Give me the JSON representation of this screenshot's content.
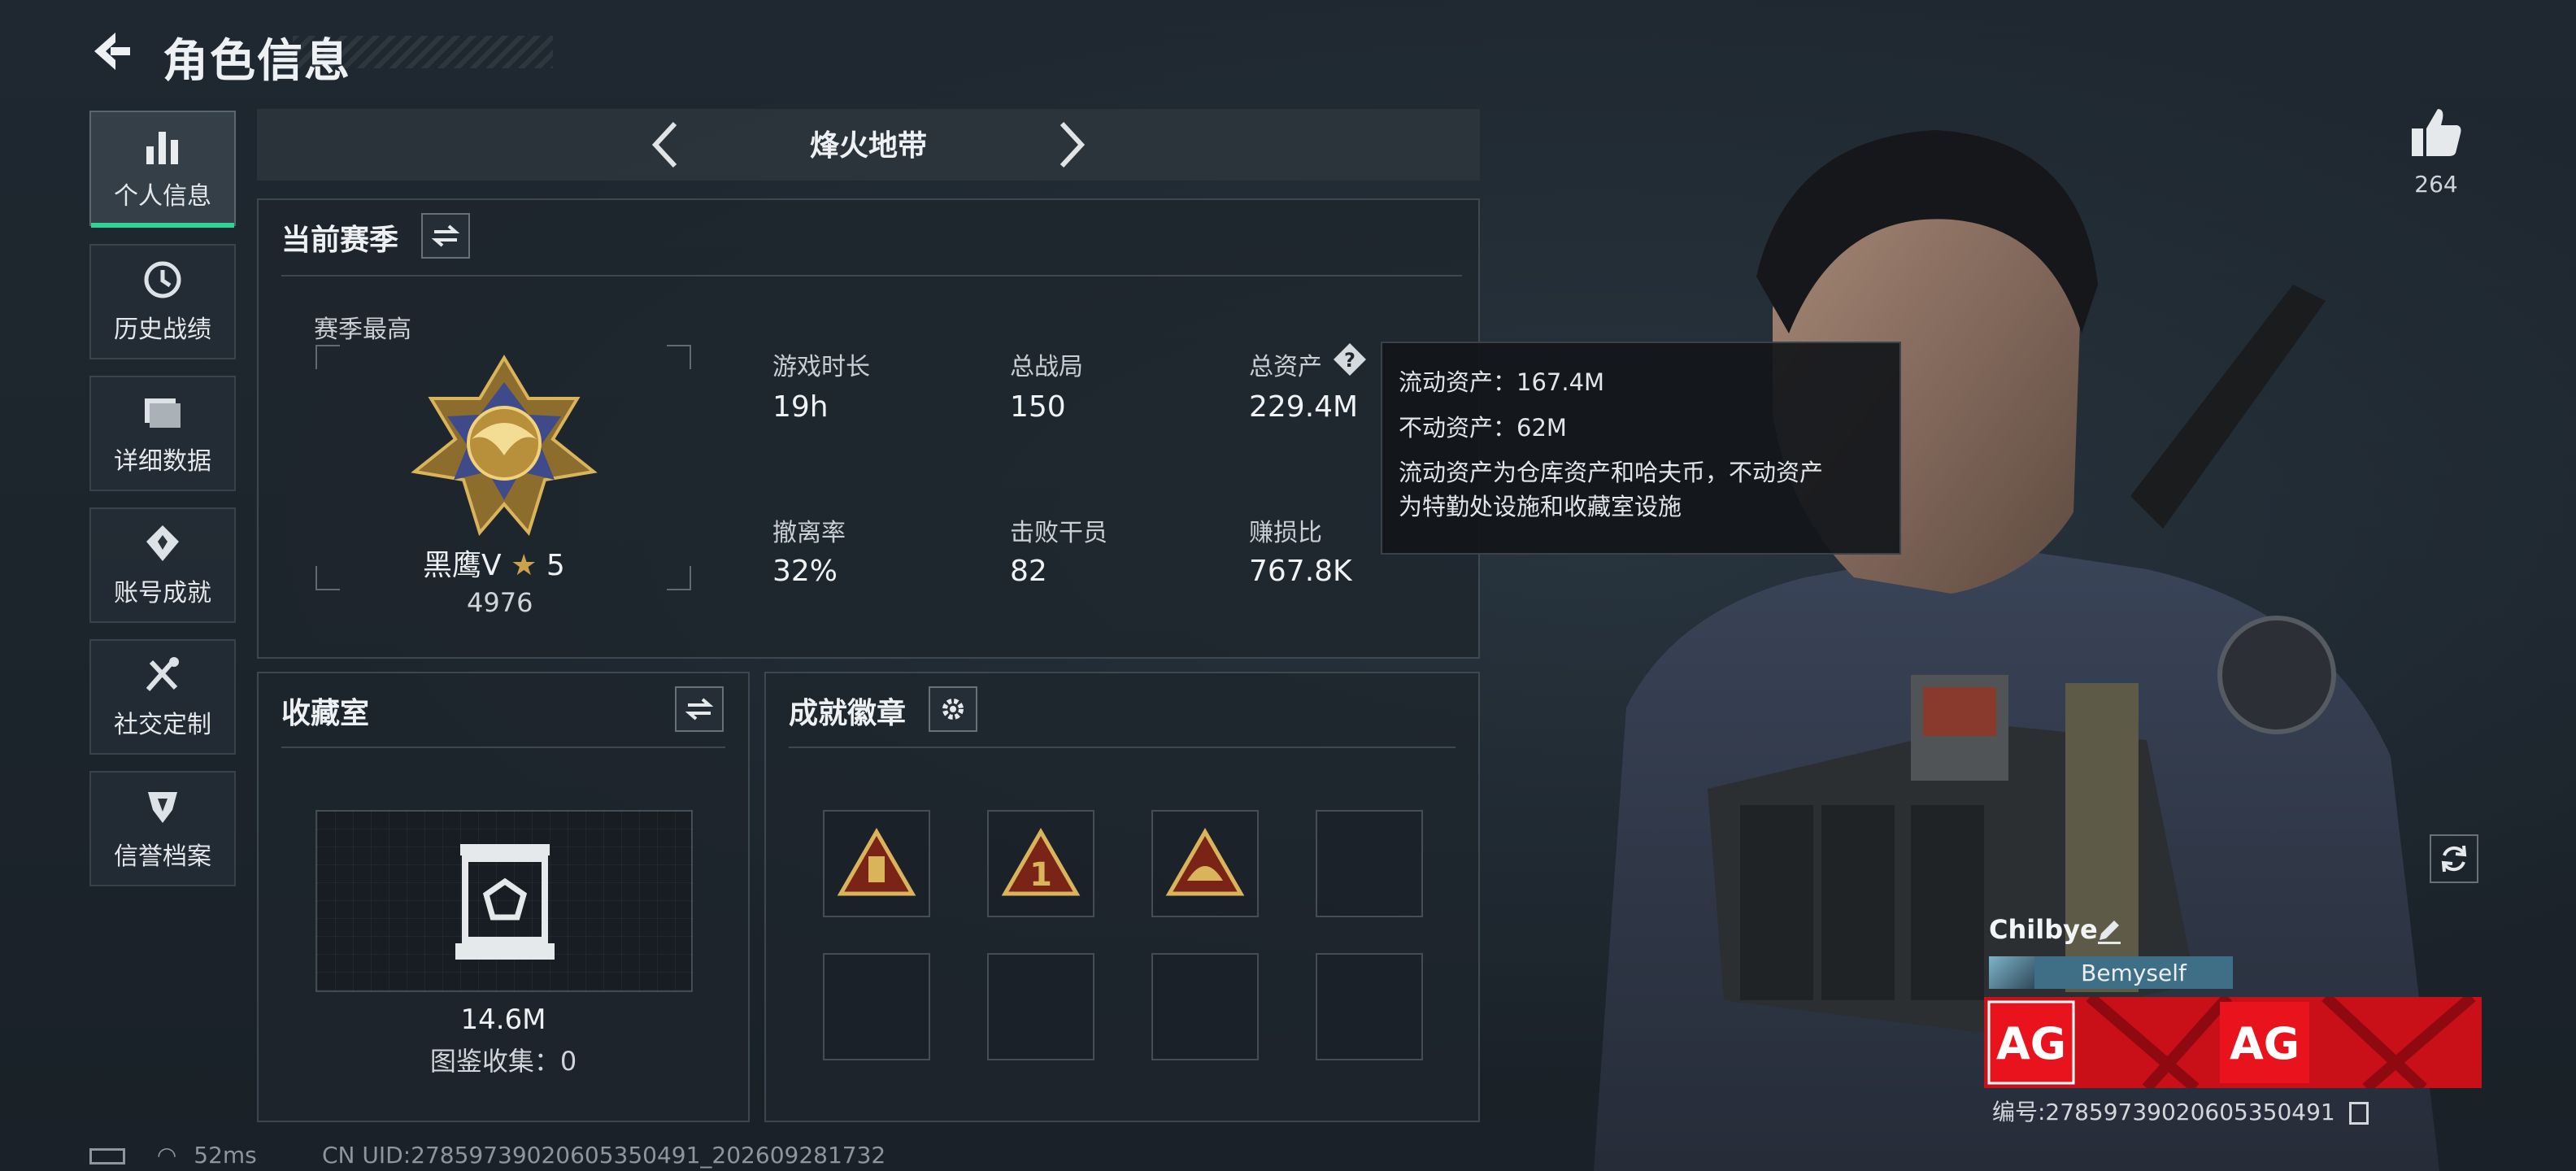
{
  "header": {
    "title": "角色信息"
  },
  "sidebar": {
    "items": [
      {
        "label": "个人信息",
        "icon": "bar-chart-icon",
        "active": true
      },
      {
        "label": "历史战绩",
        "icon": "history-icon"
      },
      {
        "label": "详细数据",
        "icon": "folder-icon"
      },
      {
        "label": "账号成就",
        "icon": "achievement-icon"
      },
      {
        "label": "社交定制",
        "icon": "tools-icon"
      },
      {
        "label": "信誉档案",
        "icon": "shield-icon"
      }
    ]
  },
  "season": {
    "name": "烽火地带"
  },
  "current_season": {
    "title": "当前赛季",
    "rank_caption": "赛季最高",
    "rank_name": "黑鹰V",
    "rank_stars": "5",
    "rank_score": "4976",
    "stats": [
      {
        "label": "游戏时长",
        "value": "19h"
      },
      {
        "label": "总战局",
        "value": "150"
      },
      {
        "label": "总资产",
        "value": "229.4M"
      },
      {
        "label": "撤离率",
        "value": "32%"
      },
      {
        "label": "击败干员",
        "value": "82"
      },
      {
        "label": "赚损比",
        "value": "767.8K"
      }
    ]
  },
  "tooltip": {
    "line1": "流动资产：167.4M",
    "line2": "不动资产：62M",
    "line3": "流动资产为仓库资产和哈夫币，不动资产",
    "line4": "为特勤处设施和收藏室设施"
  },
  "collection": {
    "title": "收藏室",
    "value": "14.6M",
    "caption": "图鉴收集：0"
  },
  "badges": {
    "title": "成就徽章"
  },
  "profile": {
    "likes": "264",
    "name": "Chilbye",
    "team": "Bemyself",
    "uid_text": "编号:2785973902060535049​1"
  },
  "status": {
    "ping": "52ms",
    "uid": "CN UID:2785973902060535049​1_202609281732"
  },
  "colors": {
    "accent": "#2fd39a",
    "banner": "#d0101a",
    "gold": "#c9a24a"
  }
}
